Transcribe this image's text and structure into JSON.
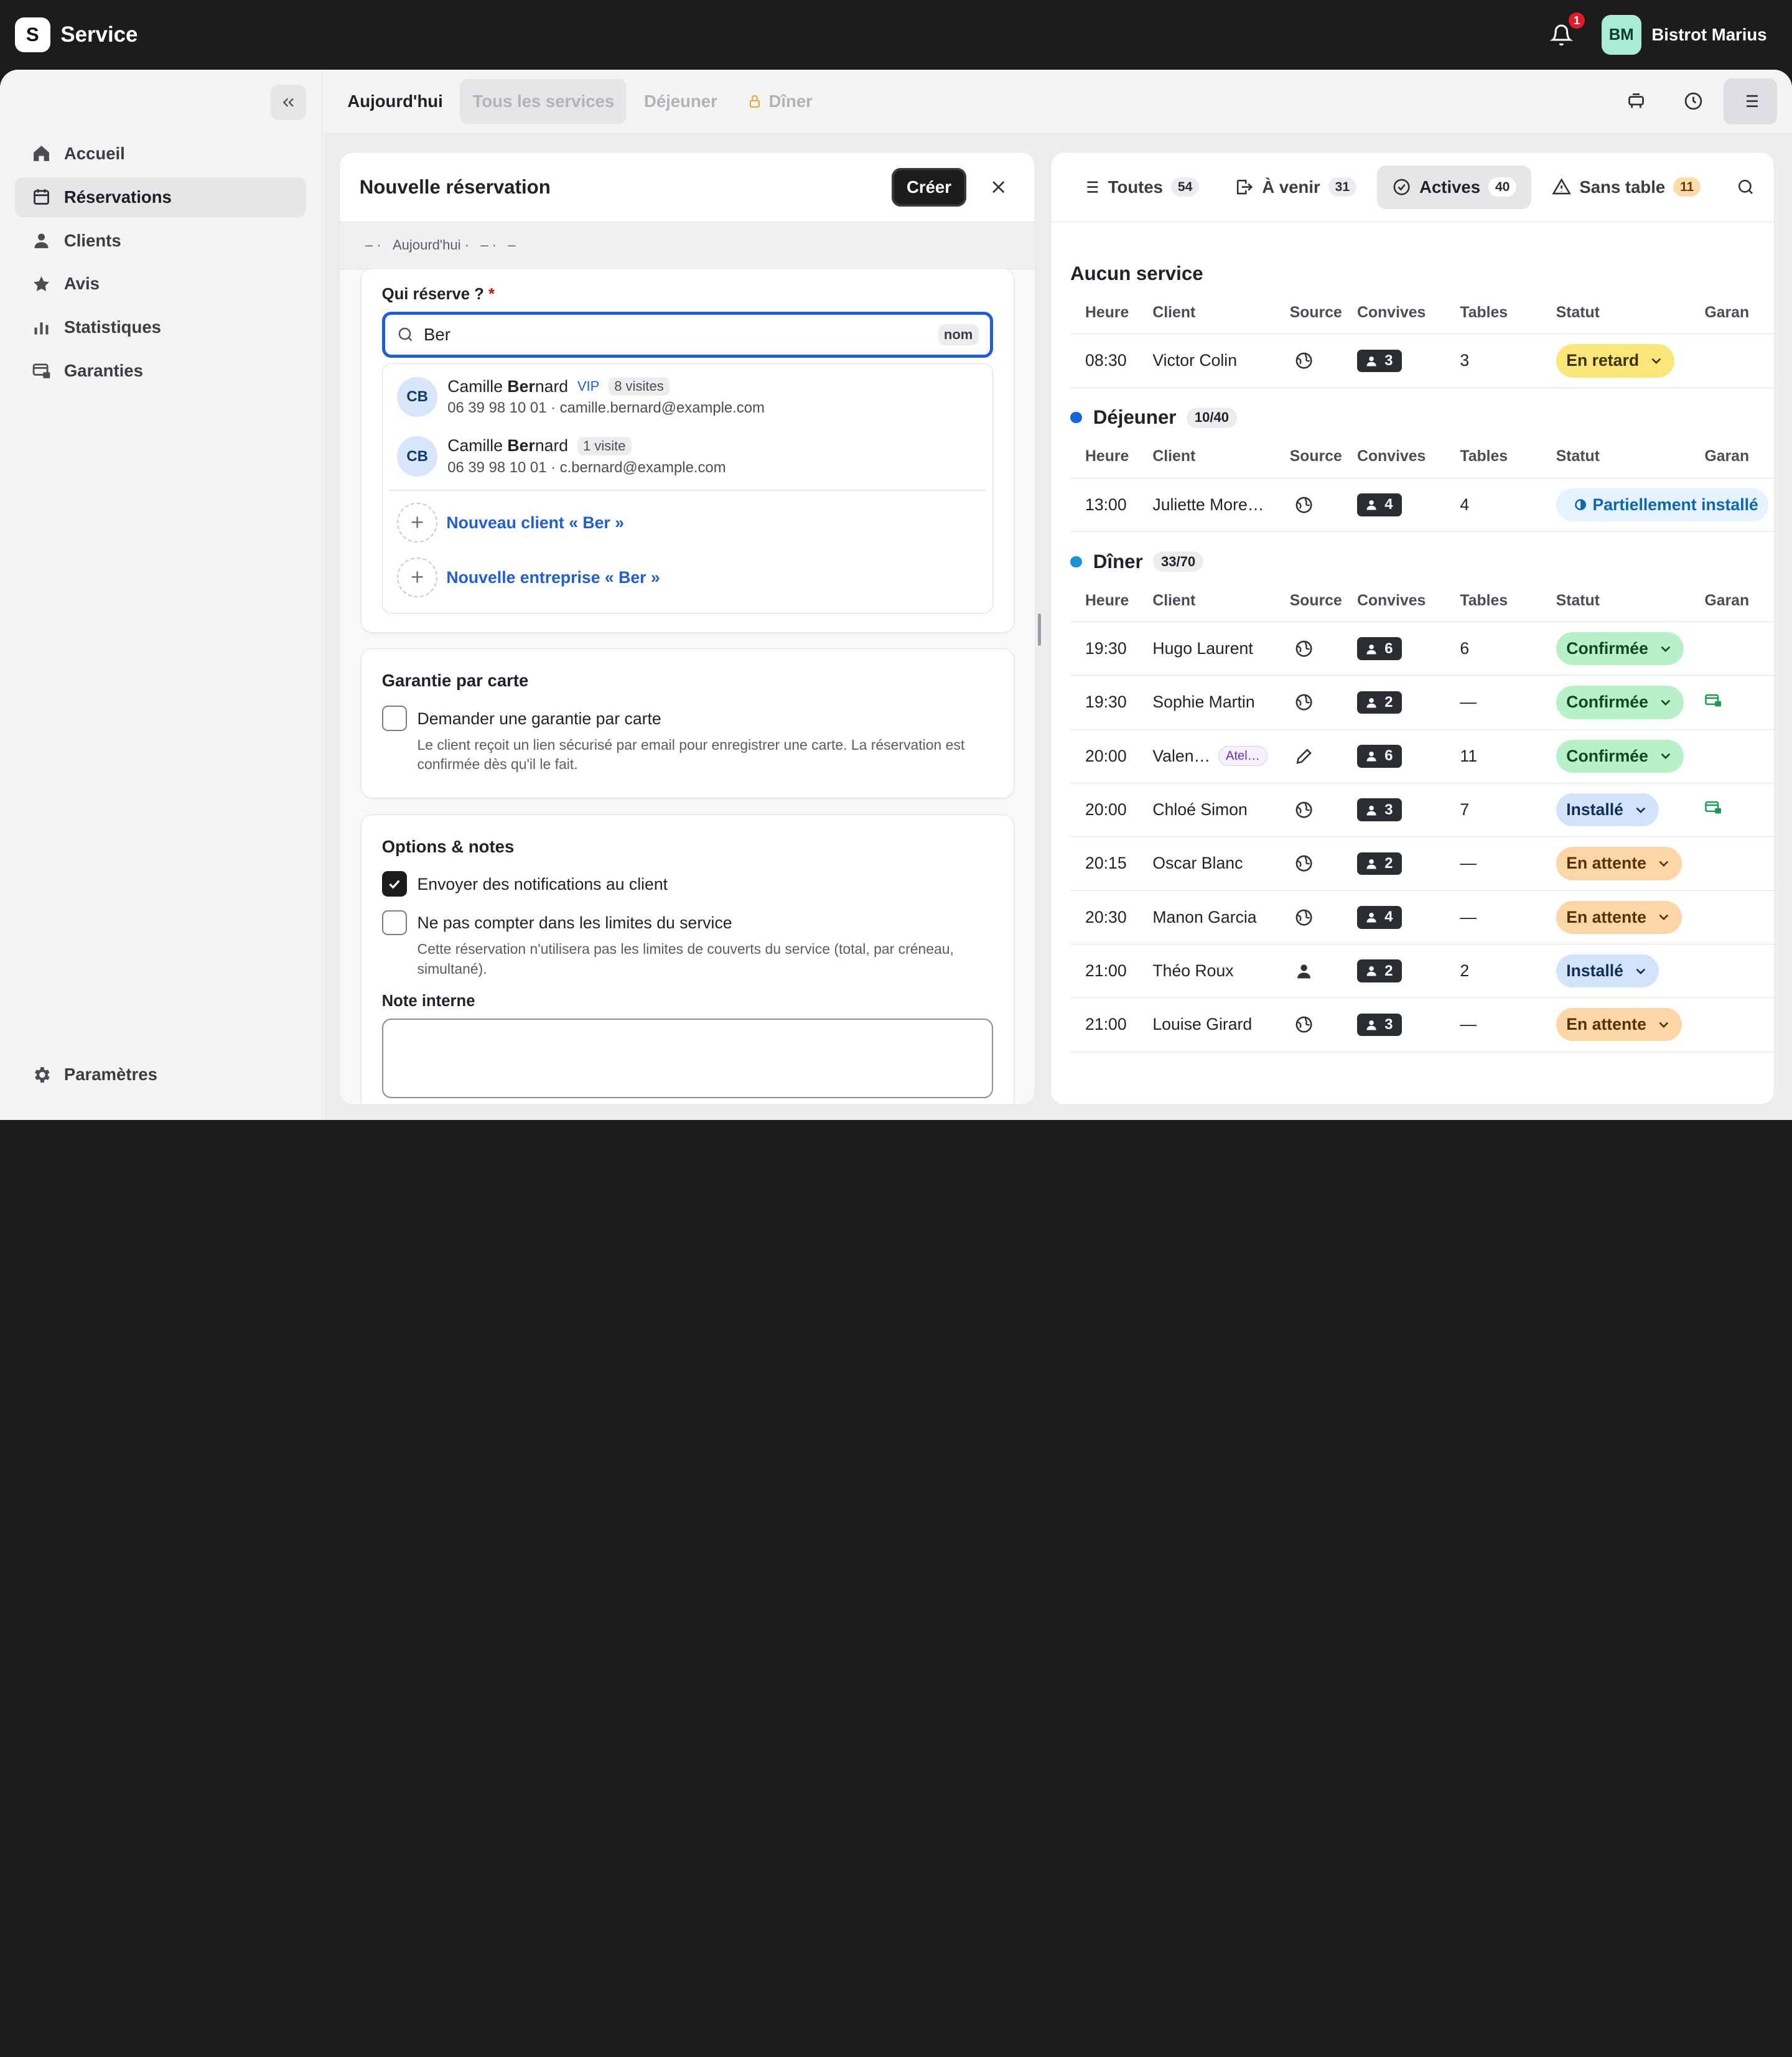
{
  "app": {
    "logo_letter": "S",
    "title": "Service"
  },
  "topbar": {
    "notifications_count": "1",
    "user_initials": "BM",
    "user_name": "Bistrot Marius"
  },
  "sidebar": {
    "items": [
      {
        "label": "Accueil",
        "icon": "home-icon"
      },
      {
        "label": "Réservations",
        "icon": "calendar-icon",
        "active": true
      },
      {
        "label": "Clients",
        "icon": "user-icon"
      },
      {
        "label": "Avis",
        "icon": "star-icon"
      },
      {
        "label": "Statistiques",
        "icon": "bar-chart-icon"
      },
      {
        "label": "Garanties",
        "icon": "card-lock-icon"
      }
    ],
    "settings_label": "Paramètres"
  },
  "service_tabs": {
    "today": "Aujourd'hui",
    "all": "Tous les services",
    "lunch": "Déjeuner",
    "dinner": "Dîner"
  },
  "new_reservation": {
    "title": "Nouvelle réservation",
    "create_label": "Créer",
    "breadcrumb": [
      "– ·",
      "Aujourd'hui ·",
      "– ·",
      "–"
    ],
    "who_label": "Qui réserve ?",
    "required_mark": "*",
    "search_value": "Ber",
    "search_tag": "nom",
    "results": [
      {
        "initials": "CB",
        "name_pre": "Camille ",
        "name_match": "Ber",
        "name_post": "nard",
        "vip": "VIP",
        "visits": "8 visites",
        "contact": "06 39 98 10 01 · camille.bernard@example.com"
      },
      {
        "initials": "CB",
        "name_pre": "Camille ",
        "name_match": "Ber",
        "name_post": "nard",
        "vip": "",
        "visits": "1 visite",
        "contact": "06 39 98 10 01 · c.bernard@example.com"
      }
    ],
    "new_client": "Nouveau client « Ber »",
    "new_company": "Nouvelle entreprise « Ber »",
    "card_guarantee": {
      "title": "Garantie par carte",
      "option": "Demander une garantie par carte",
      "desc": "Le client reçoit un lien sécurisé par email pour enregistrer une carte. La réservation est confirmée dès qu'il le fait."
    },
    "options": {
      "title": "Options & notes",
      "notify": "Envoyer des notifications au client",
      "no_limit": "Ne pas compter dans les limites du service",
      "no_limit_desc": "Cette réservation n'utilisera pas les limites de couverts du service (total, par créneau, simultané).",
      "note_label": "Note interne"
    }
  },
  "filters": [
    {
      "label": "Toutes",
      "count": "54",
      "icon": "list-icon"
    },
    {
      "label": "À venir",
      "count": "31",
      "icon": "arrival-icon"
    },
    {
      "label": "Actives",
      "count": "40",
      "icon": "check-circle-icon",
      "active": true
    },
    {
      "label": "Sans table",
      "count": "11",
      "icon": "warning-icon"
    }
  ],
  "columns": {
    "time": "Heure",
    "client": "Client",
    "source": "Source",
    "guests": "Convives",
    "tables": "Tables",
    "status": "Statut",
    "guarantee": "Garan"
  },
  "sections": [
    {
      "title": "Aucun service",
      "dot": "",
      "capacity": "",
      "rows": [
        {
          "time": "08:30",
          "client": "Victor Colin",
          "source": "globe-icon",
          "guests": "3",
          "tables": "3",
          "status": "En retard",
          "st": "late",
          "guar": false
        }
      ]
    },
    {
      "title": "Déjeuner",
      "dot": "#1565d8",
      "capacity": "10/40",
      "rows": [
        {
          "time": "13:00",
          "client": "Juliette More…",
          "source": "globe-icon",
          "guests": "4",
          "tables": "4",
          "status": "Partiellement installé",
          "st": "part",
          "guar": false
        }
      ]
    },
    {
      "title": "Dîner",
      "dot": "#1e90d8",
      "capacity": "33/70",
      "rows": [
        {
          "time": "19:30",
          "client": "Hugo Laurent",
          "source": "globe-icon",
          "guests": "6",
          "tables": "6",
          "status": "Confirmée",
          "st": "conf",
          "guar": false
        },
        {
          "time": "19:30",
          "client": "Sophie Martin",
          "source": "globe-icon",
          "guests": "2",
          "tables": "—",
          "status": "Confirmée",
          "st": "conf",
          "guar": true
        },
        {
          "time": "20:00",
          "client": "Valen…",
          "tag": "Atel…",
          "source": "pencil-icon",
          "guests": "6",
          "tables": "11",
          "status": "Confirmée",
          "st": "conf",
          "guar": false
        },
        {
          "time": "20:00",
          "client": "Chloé Simon",
          "source": "globe-icon",
          "guests": "3",
          "tables": "7",
          "status": "Installé",
          "st": "inst",
          "guar": true
        },
        {
          "time": "20:15",
          "client": "Oscar Blanc",
          "source": "globe-icon",
          "guests": "2",
          "tables": "—",
          "status": "En attente",
          "st": "wait",
          "guar": false
        },
        {
          "time": "20:30",
          "client": "Manon Garcia",
          "source": "globe-icon",
          "guests": "4",
          "tables": "—",
          "status": "En attente",
          "st": "wait",
          "guar": false
        },
        {
          "time": "21:00",
          "client": "Théo Roux",
          "source": "person-icon",
          "guests": "2",
          "tables": "2",
          "status": "Installé",
          "st": "inst",
          "guar": false
        },
        {
          "time": "21:00",
          "client": "Louise Girard",
          "source": "globe-icon",
          "guests": "3",
          "tables": "—",
          "status": "En attente",
          "st": "wait",
          "guar": false
        }
      ]
    }
  ]
}
